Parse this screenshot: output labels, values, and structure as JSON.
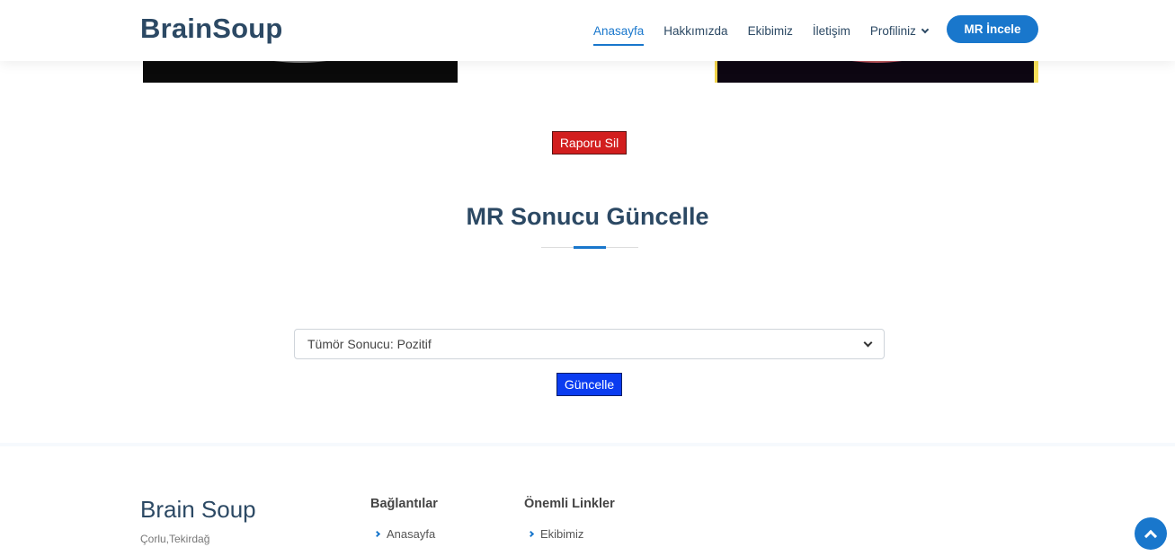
{
  "header": {
    "logo": "BrainSoup",
    "nav": [
      {
        "label": "Anasayfa",
        "active": true
      },
      {
        "label": "Hakkımızda",
        "active": false
      },
      {
        "label": "Ekibimiz",
        "active": false
      },
      {
        "label": "İletişim",
        "active": false
      },
      {
        "label": "Profiliniz",
        "active": false,
        "dropdown": true
      }
    ],
    "cta_label": "MR İncele"
  },
  "main": {
    "delete_label": "Raporu Sil",
    "title": "MR Sonucu Güncelle",
    "select_value": "Tümör Sonucu: Pozitif",
    "update_label": "Güncelle"
  },
  "footer": {
    "brand": "Brain Soup",
    "city": "Çorlu,Tekirdağ",
    "columns": [
      {
        "title": "Bağlantılar",
        "links": [
          "Anasayfa"
        ]
      },
      {
        "title": "Önemli Linkler",
        "links": [
          "Ekibimiz"
        ]
      }
    ]
  },
  "colors": {
    "primary": "#1977cc",
    "heading": "#2c4964",
    "delete": "#d21e1e",
    "update": "#0b3cf0"
  },
  "icons": {
    "dropdown": "chevron-down-icon",
    "select": "chevron-down-icon",
    "footer_link": "chevron-right-icon",
    "back_to_top": "arrow-up-icon"
  }
}
